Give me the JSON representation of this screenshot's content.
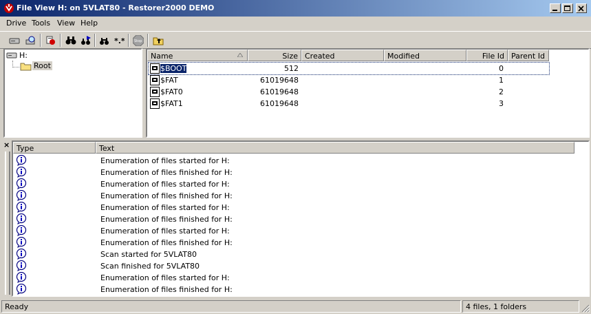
{
  "window": {
    "title": "File View H: on 5VLAT80 - Restorer2000 DEMO",
    "icon": "restorer-app-icon",
    "controls": [
      "minimize",
      "maximize",
      "close"
    ]
  },
  "menu": [
    "Drive",
    "Tools",
    "View",
    "Help"
  ],
  "toolbar": {
    "buttons": [
      "drive-icon",
      "search-drive-icon",
      "scan-icon",
      "find-icon",
      "find-next-icon",
      "filter-icon",
      "mask-icon",
      "stop-icon",
      "up-folder-icon"
    ]
  },
  "tree": {
    "drive_label": "H:",
    "root_label": "Root"
  },
  "files": {
    "columns": [
      "Name",
      "Size",
      "Created",
      "Modified",
      "File Id",
      "Parent Id"
    ],
    "rows": [
      {
        "name": "$BOOT",
        "size": "512",
        "created": "",
        "modified": "",
        "file_id": "0",
        "parent_id": ""
      },
      {
        "name": "$FAT",
        "size": "61019648",
        "created": "",
        "modified": "",
        "file_id": "1",
        "parent_id": ""
      },
      {
        "name": "$FAT0",
        "size": "61019648",
        "created": "",
        "modified": "",
        "file_id": "2",
        "parent_id": ""
      },
      {
        "name": "$FAT1",
        "size": "61019648",
        "created": "",
        "modified": "",
        "file_id": "3",
        "parent_id": ""
      }
    ]
  },
  "log": {
    "close_glyph": "×",
    "columns": [
      "Type",
      "Text"
    ],
    "rows": [
      "Enumeration of files started for H:",
      "Enumeration of files finished for H:",
      "Enumeration of files started for H:",
      "Enumeration of files finished for H:",
      "Enumeration of files started for H:",
      "Enumeration of files finished for H:",
      "Enumeration of files started for H:",
      "Enumeration of files finished for H:",
      "Scan started for 5VLAT80",
      "Scan finished for 5VLAT80",
      "Enumeration of files started for H:",
      "Enumeration of files finished for H:"
    ]
  },
  "status": {
    "left": "Ready",
    "right": "4 files, 1 folders"
  },
  "colors": {
    "title_start": "#0a246a",
    "title_end": "#a6caf0",
    "selection": "#0a246a",
    "face": "#d4d0c8"
  }
}
